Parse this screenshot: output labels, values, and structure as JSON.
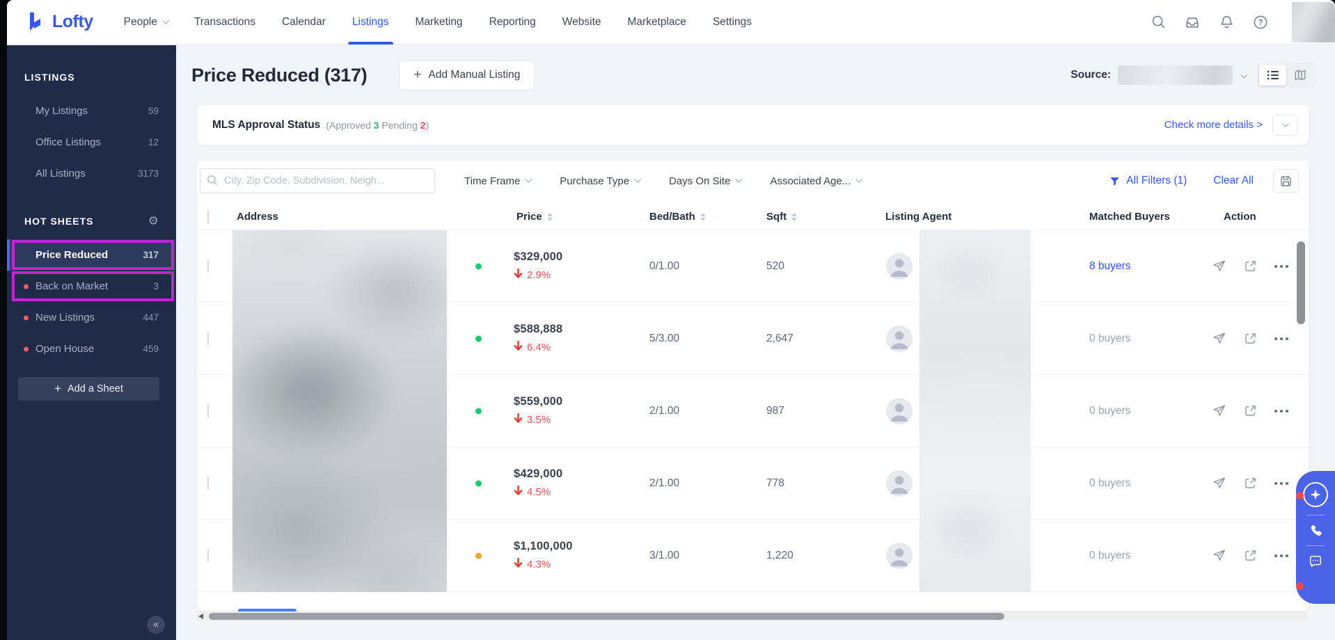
{
  "nav": {
    "brand": "Lofty",
    "items": [
      {
        "label": "People",
        "chevron": true
      },
      {
        "label": "Transactions"
      },
      {
        "label": "Calendar"
      },
      {
        "label": "Listings",
        "active": true
      },
      {
        "label": "Marketing"
      },
      {
        "label": "Reporting"
      },
      {
        "label": "Website"
      },
      {
        "label": "Marketplace"
      },
      {
        "label": "Settings"
      }
    ],
    "right_icons": [
      "search-icon",
      "inbox-icon",
      "notifications-bell-icon",
      "help-icon"
    ]
  },
  "sidebar": {
    "sections": [
      {
        "title": "LISTINGS",
        "gear": false,
        "items": [
          {
            "label": "My Listings",
            "count": "59"
          },
          {
            "label": "Office Listings",
            "count": "12"
          },
          {
            "label": "All Listings",
            "count": "3173"
          }
        ]
      },
      {
        "title": "HOT SHEETS",
        "gear": true,
        "items": [
          {
            "label": "Price Reduced",
            "count": "317",
            "active": true,
            "annotated": true
          },
          {
            "label": "Back on Market",
            "count": "3",
            "dot": true,
            "annotated": true
          },
          {
            "label": "New Listings",
            "count": "447",
            "dot": true
          },
          {
            "label": "Open House",
            "count": "459",
            "dot": true
          }
        ]
      }
    ],
    "add_sheet_label": "Add a Sheet"
  },
  "header": {
    "title": "Price Reduced (317)",
    "add_manual_listing": "Add Manual Listing",
    "source_label": "Source:"
  },
  "mls_bar": {
    "title": "MLS Approval Status",
    "sub_prefix": "(Approved",
    "approved_count": "3",
    "sub_mid": "Pending",
    "pending_count": "2",
    "sub_suffix": ")",
    "details_link": "Check more details >"
  },
  "filter_bar": {
    "search_placeholder": "City, Zip Code, Subdivision, Neigh...",
    "dropdowns": [
      "Time Frame",
      "Purchase Type",
      "Days On Site",
      "Associated Age..."
    ],
    "all_filters_label": "All Filters (1)",
    "clear_all_label": "Clear All"
  },
  "table": {
    "columns": [
      "Address",
      "Price",
      "Bed/Bath",
      "Sqft",
      "Listing Agent",
      "Matched Buyers",
      "Action"
    ],
    "sortable_columns": [
      "Price",
      "Bed/Bath",
      "Sqft"
    ],
    "rows": [
      {
        "status_color": "#21c773",
        "price": "$329,000",
        "price_drop": "2.9%",
        "bed_bath": "0/1.00",
        "sqft": "520",
        "matched_buyers": "8 buyers",
        "buyers_is_link": true
      },
      {
        "status_color": "#21c773",
        "price": "$588,888",
        "price_drop": "6.4%",
        "bed_bath": "5/3.00",
        "sqft": "2,647",
        "matched_buyers": "0 buyers",
        "buyers_is_link": false
      },
      {
        "status_color": "#21c773",
        "price": "$559,000",
        "price_drop": "3.5%",
        "bed_bath": "2/1.00",
        "sqft": "987",
        "matched_buyers": "0 buyers",
        "buyers_is_link": false
      },
      {
        "status_color": "#21c773",
        "price": "$429,000",
        "price_drop": "4.5%",
        "bed_bath": "2/1.00",
        "sqft": "778",
        "matched_buyers": "0 buyers",
        "buyers_is_link": false
      },
      {
        "status_color": "#f2a62e",
        "price": "$1,100,000",
        "price_drop": "4.3%",
        "bed_bath": "3/1.00",
        "sqft": "1,220",
        "matched_buyers": "0 buyers",
        "buyers_is_link": false
      }
    ]
  },
  "icons": {
    "gear": "⚙",
    "collapse": "«",
    "plus": "+",
    "action_icons": [
      "send-icon",
      "open-listing-icon",
      "more-ellipsis-icon"
    ],
    "float_widget_icons": [
      "ai-sparkle-icon",
      "phone-icon",
      "chat-bubble-icon"
    ]
  },
  "colors": {
    "accent_blue": "#3657e8",
    "link_blue": "#3d5be0",
    "green": "#27b96e",
    "red": "#e8505b",
    "orange": "#f2a62e",
    "status_green": "#21c773",
    "sidebar_bg": "#202b49",
    "annotation_magenta": "#c224cf",
    "widget_blue": "#4a63e7"
  }
}
